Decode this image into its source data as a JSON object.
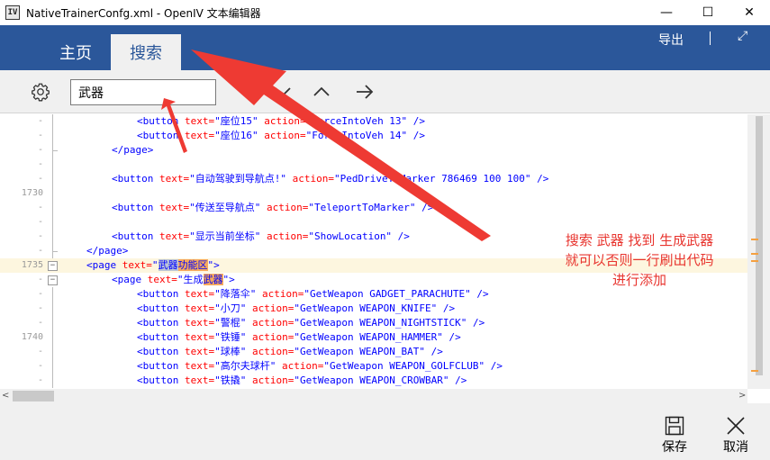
{
  "window": {
    "app_icon": "IV",
    "title": "NativeTrainerConfg.xml - OpenIV 文本编辑器",
    "controls": {
      "minimize": "—",
      "maximize": "☐",
      "close": "✕"
    }
  },
  "header": {
    "tabs": [
      {
        "label": "主页"
      },
      {
        "label": "搜索"
      }
    ],
    "export_label": "导出",
    "expand_icon": "⤢"
  },
  "toolbar": {
    "search_value": "武器"
  },
  "editor": {
    "line_numbers": {
      "l3": "1730",
      "l10": "1735",
      "l15": "1740"
    },
    "lines": [
      {
        "c1": "<button",
        "c2": " text=",
        "c3": "\"座位15\"",
        "c4": " action=",
        "c5": "\"ForceIntoVeh 13\"",
        "c6": " />"
      },
      {
        "c1": "<button",
        "c2": " text=",
        "c3": "\"座位16\"",
        "c4": " action=",
        "c5": "\"ForceIntoVeh 14\"",
        "c6": " />"
      },
      {
        "c1": "</page>"
      },
      {
        "c1": "<button",
        "c2": " text=",
        "c3": "\"自动驾驶到导航点!\"",
        "c4": " action=",
        "c5": "\"PedDriveToMarker 786469 100 100\"",
        "c6": " />"
      },
      {
        "c1": "<button",
        "c2": " text=",
        "c3": "\"传送至导航点\"",
        "c4": " action=",
        "c5": "\"TeleportToMarker\"",
        "c6": " />"
      },
      {
        "c1": "<button",
        "c2": " text=",
        "c3": "\"显示当前坐标\"",
        "c4": " action=",
        "c5": "\"ShowLocation\"",
        "c6": " />"
      },
      {
        "c1": "</page>"
      },
      {
        "c1": "<page",
        "c2": " text=",
        "c3a": "\"",
        "c3b": "武器",
        "c3c": "功能区",
        "c3d": "\"",
        "c6": ">"
      },
      {
        "c1": "<page",
        "c2": " text=",
        "c3a": "\"生成",
        "c3b": "武器",
        "c3d": "\"",
        "c6": ">"
      },
      {
        "c1": "<button",
        "c2": " text=",
        "c3": "\"降落伞\"",
        "c4": " action=",
        "c5": "\"GetWeapon GADGET_PARACHUTE\"",
        "c6": " />"
      },
      {
        "c1": "<button",
        "c2": " text=",
        "c3": "\"小刀\"",
        "c4": " action=",
        "c5": "\"GetWeapon WEAPON_KNIFE\"",
        "c6": " />"
      },
      {
        "c1": "<button",
        "c2": " text=",
        "c3": "\"警棍\"",
        "c4": " action=",
        "c5": "\"GetWeapon WEAPON_NIGHTSTICK\"",
        "c6": " />"
      },
      {
        "c1": "<button",
        "c2": " text=",
        "c3": "\"铁锤\"",
        "c4": " action=",
        "c5": "\"GetWeapon WEAPON_HAMMER\"",
        "c6": " />"
      },
      {
        "c1": "<button",
        "c2": " text=",
        "c3": "\"球棒\"",
        "c4": " action=",
        "c5": "\"GetWeapon WEAPON_BAT\"",
        "c6": " />"
      },
      {
        "c1": "<button",
        "c2": " text=",
        "c3": "\"高尔夫球杆\"",
        "c4": " action=",
        "c5": "\"GetWeapon WEAPON_GOLFCLUB\"",
        "c6": " />"
      },
      {
        "c1": "<button",
        "c2": " text=",
        "c3": "\"铁撬\"",
        "c4": " action=",
        "c5": "\"GetWeapon WEAPON_CROWBAR\"",
        "c6": " />"
      }
    ]
  },
  "scroll": {
    "left_arrow": "<",
    "right_arrow": ">"
  },
  "bottom": {
    "save_label": "保存",
    "cancel_label": "取消"
  },
  "annotation": {
    "line1": "搜索 武器 找到 生成武器",
    "line2": "就可以否则一行刷出代码",
    "line3": "进行添加",
    "color": "#e8352f"
  },
  "colors": {
    "accent": "#2b579a",
    "highlight_match": "#f7a95c",
    "highlight_current": "#bcc5d6"
  }
}
